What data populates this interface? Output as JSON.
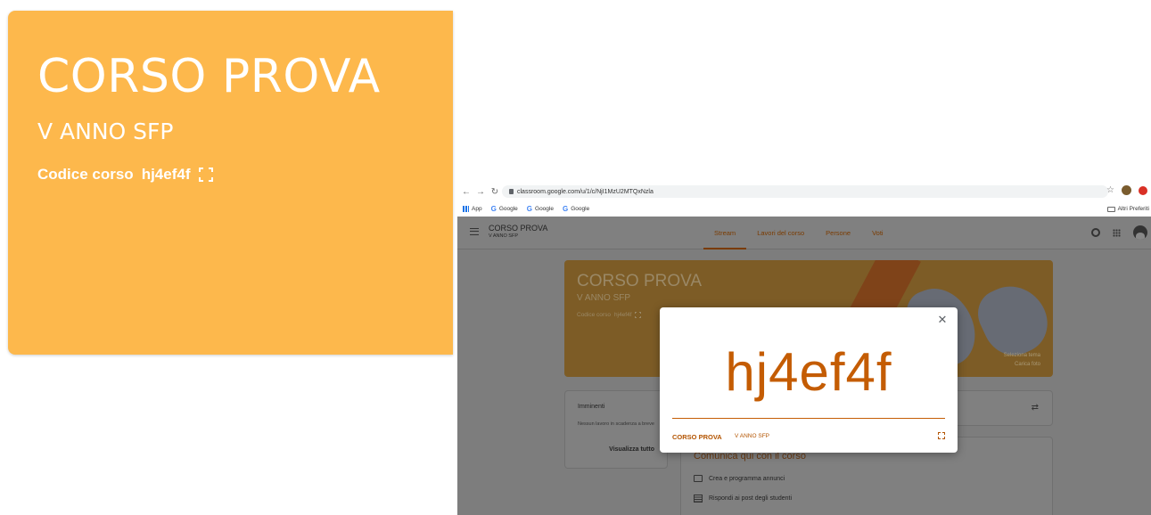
{
  "zoom_card": {
    "title": "CORSO PROVA",
    "subtitle": "V ANNO SFP",
    "code_label": "Codice corso",
    "code_value": "hj4ef4f",
    "icon": "fullscreen-icon",
    "color": "#fdb84c"
  },
  "browser": {
    "url": "classroom.google.com/u/1/c/NjI1MzU2MTQxNzla",
    "bookmarks": [
      "App",
      "Google",
      "Google",
      "Google"
    ],
    "other_bookmarks": "Altri Preferiti"
  },
  "classroom": {
    "course_title": "CORSO PROVA",
    "course_sub": "V ANNO SFP",
    "tabs": [
      {
        "label": "Stream",
        "active": true
      },
      {
        "label": "Lavori del corso",
        "active": false
      },
      {
        "label": "Persone",
        "active": false
      },
      {
        "label": "Voti",
        "active": false
      }
    ],
    "banner": {
      "title": "CORSO PROVA",
      "subtitle": "V ANNO SFP",
      "code_label": "Codice corso",
      "code_value": "hj4ef4f",
      "select_theme": "Seleziona tema",
      "upload_photo": "Carica foto"
    },
    "upcoming": {
      "title": "Imminenti",
      "text": "Nessun lavoro in scadenza a breve",
      "link": "Visualizza tutto"
    },
    "communicate": {
      "title": "Comunica qui con il corso",
      "row1": "Crea e programma annunci",
      "row2": "Rispondi ai post degli studenti"
    }
  },
  "dialog": {
    "code": "hj4ef4f",
    "course": "CORSO PROVA",
    "sub": "V ANNO SFP",
    "accent": "#c45c03"
  }
}
